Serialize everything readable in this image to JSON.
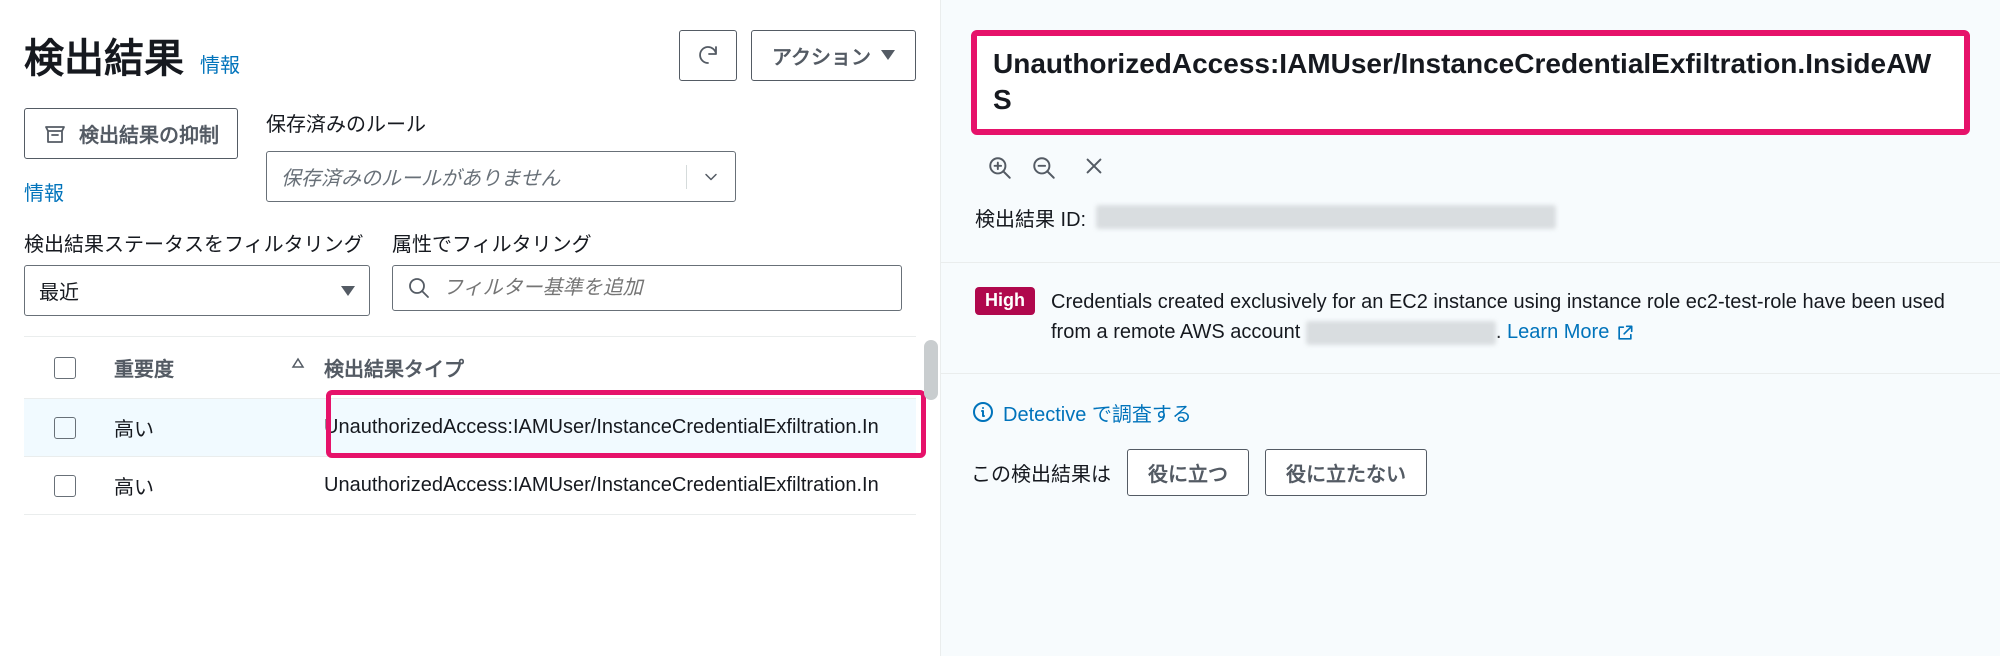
{
  "page": {
    "title": "検出結果",
    "info": "情報"
  },
  "actions": {
    "action_label": "アクション"
  },
  "suppress": {
    "button": "検出結果の抑制",
    "info": "情報"
  },
  "saved_rules": {
    "label": "保存済みのルール",
    "placeholder": "保存済みのルールがありません"
  },
  "filters": {
    "status_label": "検出結果ステータスをフィルタリング",
    "status_value": "最近",
    "attr_label": "属性でフィルタリング",
    "attr_placeholder": "フィルター基準を追加"
  },
  "table": {
    "headers": {
      "severity": "重要度",
      "finding_type": "検出結果タイプ"
    },
    "rows": [
      {
        "severity": "高い",
        "type": "UnauthorizedAccess:IAMUser/InstanceCredentialExfiltration.In",
        "selected": true
      },
      {
        "severity": "高い",
        "type": "UnauthorizedAccess:IAMUser/InstanceCredentialExfiltration.In",
        "selected": false
      }
    ]
  },
  "detail": {
    "title": "UnauthorizedAccess:IAMUser/InstanceCredentialExfiltration.InsideAWS",
    "finding_id_label": "検出結果 ID:",
    "badge": "High",
    "description_pre": "Credentials created exclusively for an EC2 instance using instance role ec2-test-role have been used from a remote AWS account ",
    "description_post": ". ",
    "learn_more": "Learn More",
    "detective_link": "Detective で調査する",
    "feedback_label": "この検出結果は",
    "useful": "役に立つ",
    "not_useful": "役に立たない"
  }
}
